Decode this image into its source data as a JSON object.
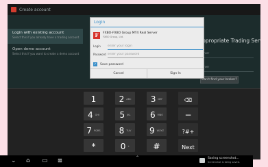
{
  "app": {
    "title": "Create account",
    "left_items": [
      {
        "title": "Login with existing account",
        "subtitle": "Select this if you already have a trading account"
      },
      {
        "title": "Open demo account",
        "subtitle": "Select this if you want to create a demo account"
      }
    ],
    "right_heading": "Appropriate Trading Server",
    "right_fields": [
      "Server",
      "Server"
    ],
    "cant_find_button": "Can't find your broker?"
  },
  "dialog": {
    "title": "Login",
    "server": {
      "icon_letter": "F",
      "name": "FXBO-FXBO Group MT4 Real Server",
      "description": "FXBO Group, Ltd."
    },
    "login_label": "Login",
    "login_placeholder": "enter your login",
    "password_label": "Password",
    "password_placeholder": "enter your password",
    "save_password_label": "Save password",
    "save_password_checked": true,
    "cancel_button": "Cancel",
    "signin_button": "Sign In"
  },
  "keyboard": {
    "rows": [
      [
        {
          "main": "1",
          "sub": ""
        },
        {
          "main": "2",
          "sub": "ABC"
        },
        {
          "main": "3",
          "sub": "DEF"
        },
        {
          "main": "",
          "sub": "",
          "icon": "backspace-icon",
          "glyph": "⌫"
        }
      ],
      [
        {
          "main": "4",
          "sub": "GHI"
        },
        {
          "main": "5",
          "sub": "JKL"
        },
        {
          "main": "6",
          "sub": "MNO"
        },
        {
          "main": "−",
          "sub": ""
        }
      ],
      [
        {
          "main": "7",
          "sub": "PQRS"
        },
        {
          "main": "8",
          "sub": "TUV"
        },
        {
          "main": "9",
          "sub": "WXYZ"
        },
        {
          "main": "?#+",
          "sub": ""
        }
      ],
      [
        {
          "main": "*",
          "sub": ""
        },
        {
          "main": "0",
          "sub": "+"
        },
        {
          "main": "#",
          "sub": ""
        },
        {
          "main": "Next",
          "sub": ""
        }
      ]
    ]
  },
  "navbar": {
    "back_icon": "back-icon",
    "home_icon": "home-icon",
    "recents_icon": "recent-apps-icon",
    "screenshot_icon": "screenshot-icon",
    "notification_title": "Saving screenshot...",
    "notification_subtitle": "Screenshot is being saved."
  }
}
